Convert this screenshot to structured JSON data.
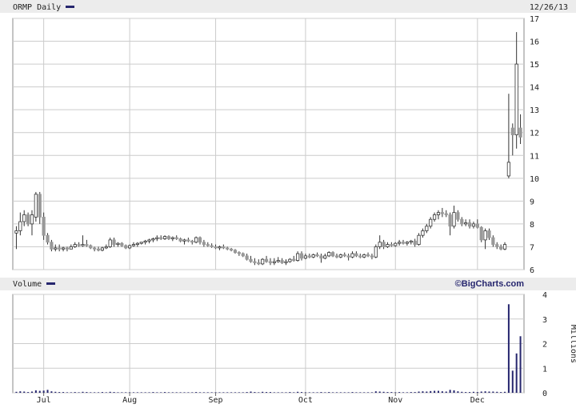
{
  "chart_data": [
    {
      "type": "candlestick",
      "ticker_label": "ORMP Daily",
      "date_label": "12/26/13",
      "y_ticks": [
        6,
        7,
        8,
        9,
        10,
        11,
        12,
        13,
        14,
        15,
        16,
        17
      ],
      "ylim": [
        6,
        17
      ],
      "x_labels": [
        "Jul",
        "Aug",
        "Sep",
        "Oct",
        "Nov",
        "Dec"
      ],
      "grid": true,
      "legend_color": "#26266e",
      "up_color": "#ffffff",
      "down_color": "#999999",
      "outline_color": "#333333",
      "candles": [
        [
          7.6,
          7.9,
          6.9,
          7.7
        ],
        [
          7.7,
          8.5,
          7.5,
          8.1
        ],
        [
          8.1,
          8.6,
          7.9,
          8.4
        ],
        [
          8.4,
          8.5,
          7.9,
          8.0
        ],
        [
          8.0,
          8.6,
          7.5,
          8.4
        ],
        [
          8.3,
          9.4,
          8.1,
          9.3
        ],
        [
          9.3,
          9.4,
          8.0,
          8.3
        ],
        [
          8.3,
          8.5,
          7.3,
          7.5
        ],
        [
          7.5,
          7.6,
          7.1,
          7.2
        ],
        [
          7.2,
          7.3,
          6.8,
          6.9
        ],
        [
          6.9,
          7.1,
          6.8,
          6.95
        ],
        [
          6.95,
          7.1,
          6.8,
          6.9
        ],
        [
          6.9,
          7.0,
          6.8,
          6.95
        ],
        [
          6.95,
          7.0,
          6.8,
          6.9
        ],
        [
          6.9,
          7.1,
          6.9,
          7.0
        ],
        [
          7.0,
          7.2,
          6.95,
          7.1
        ],
        [
          7.1,
          7.2,
          7.0,
          7.05
        ],
        [
          7.05,
          7.5,
          7.0,
          7.1
        ],
        [
          7.1,
          7.3,
          7.0,
          7.05
        ],
        [
          7.05,
          7.1,
          6.9,
          6.95
        ],
        [
          6.95,
          7.0,
          6.8,
          6.9
        ],
        [
          6.9,
          7.0,
          6.8,
          6.85
        ],
        [
          6.85,
          7.0,
          6.8,
          6.95
        ],
        [
          6.95,
          7.1,
          6.9,
          7.0
        ],
        [
          7.0,
          7.4,
          6.95,
          7.3
        ],
        [
          7.3,
          7.4,
          7.0,
          7.1
        ],
        [
          7.1,
          7.2,
          7.0,
          7.15
        ],
        [
          7.15,
          7.2,
          7.0,
          7.05
        ],
        [
          7.05,
          7.1,
          6.9,
          6.95
        ],
        [
          6.95,
          7.1,
          6.9,
          7.05
        ],
        [
          7.05,
          7.2,
          7.0,
          7.1
        ],
        [
          7.1,
          7.2,
          7.0,
          7.15
        ],
        [
          7.15,
          7.2,
          7.1,
          7.2
        ],
        [
          7.2,
          7.3,
          7.1,
          7.25
        ],
        [
          7.25,
          7.35,
          7.15,
          7.3
        ],
        [
          7.3,
          7.4,
          7.2,
          7.35
        ],
        [
          7.35,
          7.5,
          7.25,
          7.4
        ],
        [
          7.4,
          7.5,
          7.3,
          7.35
        ],
        [
          7.35,
          7.5,
          7.3,
          7.45
        ],
        [
          7.45,
          7.5,
          7.3,
          7.35
        ],
        [
          7.35,
          7.45,
          7.25,
          7.4
        ],
        [
          7.4,
          7.5,
          7.3,
          7.35
        ],
        [
          7.35,
          7.4,
          7.2,
          7.25
        ],
        [
          7.25,
          7.35,
          7.1,
          7.3
        ],
        [
          7.3,
          7.4,
          7.2,
          7.25
        ],
        [
          7.25,
          7.3,
          7.1,
          7.2
        ],
        [
          7.2,
          7.45,
          7.15,
          7.4
        ],
        [
          7.4,
          7.45,
          7.1,
          7.2
        ],
        [
          7.2,
          7.3,
          7.0,
          7.1
        ],
        [
          7.1,
          7.2,
          7.0,
          7.05
        ],
        [
          7.05,
          7.15,
          6.95,
          7.0
        ],
        [
          7.0,
          7.1,
          6.9,
          6.95
        ],
        [
          6.95,
          7.05,
          6.85,
          7.0
        ],
        [
          7.0,
          7.1,
          6.9,
          6.95
        ],
        [
          6.95,
          7.0,
          6.85,
          6.9
        ],
        [
          6.9,
          6.95,
          6.8,
          6.85
        ],
        [
          6.85,
          6.9,
          6.7,
          6.75
        ],
        [
          6.75,
          6.8,
          6.6,
          6.7
        ],
        [
          6.7,
          6.75,
          6.55,
          6.6
        ],
        [
          6.6,
          6.7,
          6.4,
          6.45
        ],
        [
          6.45,
          6.6,
          6.3,
          6.35
        ],
        [
          6.35,
          6.5,
          6.2,
          6.3
        ],
        [
          6.3,
          6.45,
          6.2,
          6.25
        ],
        [
          6.25,
          6.5,
          6.2,
          6.45
        ],
        [
          6.45,
          6.6,
          6.3,
          6.35
        ],
        [
          6.35,
          6.5,
          6.2,
          6.3
        ],
        [
          6.3,
          6.5,
          6.2,
          6.35
        ],
        [
          6.35,
          6.55,
          6.3,
          6.4
        ],
        [
          6.4,
          6.5,
          6.25,
          6.3
        ],
        [
          6.3,
          6.45,
          6.2,
          6.35
        ],
        [
          6.35,
          6.5,
          6.3,
          6.45
        ],
        [
          6.45,
          6.6,
          6.35,
          6.4
        ],
        [
          6.4,
          6.8,
          6.35,
          6.7
        ],
        [
          6.7,
          6.8,
          6.4,
          6.5
        ],
        [
          6.5,
          6.7,
          6.45,
          6.6
        ],
        [
          6.6,
          6.7,
          6.5,
          6.55
        ],
        [
          6.55,
          6.7,
          6.5,
          6.65
        ],
        [
          6.65,
          6.75,
          6.55,
          6.6
        ],
        [
          6.6,
          6.7,
          6.3,
          6.5
        ],
        [
          6.5,
          6.7,
          6.45,
          6.6
        ],
        [
          6.6,
          6.8,
          6.55,
          6.75
        ],
        [
          6.75,
          6.8,
          6.55,
          6.6
        ],
        [
          6.6,
          6.7,
          6.5,
          6.55
        ],
        [
          6.55,
          6.7,
          6.5,
          6.65
        ],
        [
          6.65,
          6.75,
          6.55,
          6.6
        ],
        [
          6.6,
          6.7,
          6.4,
          6.55
        ],
        [
          6.55,
          6.8,
          6.5,
          6.7
        ],
        [
          6.7,
          6.8,
          6.55,
          6.6
        ],
        [
          6.6,
          6.7,
          6.5,
          6.55
        ],
        [
          6.55,
          6.7,
          6.5,
          6.65
        ],
        [
          6.65,
          6.75,
          6.55,
          6.6
        ],
        [
          6.6,
          6.7,
          6.45,
          6.55
        ],
        [
          6.55,
          7.1,
          6.5,
          7.0
        ],
        [
          7.0,
          7.5,
          6.9,
          7.2
        ],
        [
          7.2,
          7.3,
          6.9,
          7.0
        ],
        [
          7.0,
          7.2,
          6.95,
          7.1
        ],
        [
          7.1,
          7.2,
          7.0,
          7.05
        ],
        [
          7.05,
          7.2,
          7.0,
          7.15
        ],
        [
          7.15,
          7.3,
          7.05,
          7.2
        ],
        [
          7.2,
          7.3,
          7.1,
          7.15
        ],
        [
          7.15,
          7.25,
          7.05,
          7.2
        ],
        [
          7.2,
          7.3,
          7.1,
          7.25
        ],
        [
          7.25,
          7.35,
          7.0,
          7.1
        ],
        [
          7.1,
          7.6,
          7.05,
          7.5
        ],
        [
          7.5,
          7.8,
          7.4,
          7.7
        ],
        [
          7.7,
          8.0,
          7.6,
          7.9
        ],
        [
          7.9,
          8.3,
          7.8,
          8.2
        ],
        [
          8.2,
          8.5,
          8.1,
          8.4
        ],
        [
          8.4,
          8.6,
          8.2,
          8.5
        ],
        [
          8.5,
          8.7,
          8.3,
          8.45
        ],
        [
          8.45,
          8.6,
          8.3,
          8.4
        ],
        [
          8.4,
          8.5,
          7.5,
          7.9
        ],
        [
          7.9,
          8.8,
          7.8,
          8.5
        ],
        [
          8.5,
          8.6,
          8.1,
          8.2
        ],
        [
          8.2,
          8.3,
          7.9,
          8.0
        ],
        [
          8.0,
          8.2,
          7.9,
          8.05
        ],
        [
          8.05,
          8.2,
          7.8,
          7.9
        ],
        [
          7.9,
          8.1,
          7.8,
          8.0
        ],
        [
          8.0,
          8.2,
          7.8,
          7.85
        ],
        [
          7.85,
          7.9,
          7.2,
          7.3
        ],
        [
          7.3,
          7.8,
          6.9,
          7.7
        ],
        [
          7.7,
          7.8,
          7.3,
          7.4
        ],
        [
          7.4,
          7.5,
          7.0,
          7.1
        ],
        [
          7.1,
          7.2,
          6.9,
          7.0
        ],
        [
          7.0,
          7.1,
          6.85,
          6.9
        ],
        [
          6.9,
          7.2,
          6.85,
          7.1
        ],
        [
          10.1,
          13.7,
          10.0,
          10.7
        ],
        [
          12.2,
          12.4,
          11.0,
          11.9
        ],
        [
          11.9,
          16.4,
          11.3,
          15.0
        ],
        [
          12.2,
          12.8,
          11.5,
          11.8
        ]
      ]
    },
    {
      "type": "bar",
      "title": "Volume",
      "brand": "©BigCharts.com",
      "y_ticks": [
        0,
        1,
        2,
        3,
        4
      ],
      "ylim": [
        0,
        4
      ],
      "ylabel": "Millions",
      "bar_color": "#26266e",
      "values": [
        0.04,
        0.06,
        0.05,
        0.03,
        0.05,
        0.1,
        0.08,
        0.09,
        0.12,
        0.06,
        0.04,
        0.03,
        0.03,
        0.02,
        0.02,
        0.03,
        0.02,
        0.04,
        0.03,
        0.02,
        0.02,
        0.02,
        0.03,
        0.02,
        0.04,
        0.03,
        0.02,
        0.02,
        0.02,
        0.02,
        0.02,
        0.02,
        0.02,
        0.02,
        0.02,
        0.03,
        0.02,
        0.02,
        0.03,
        0.02,
        0.02,
        0.02,
        0.02,
        0.02,
        0.02,
        0.02,
        0.03,
        0.02,
        0.02,
        0.02,
        0.02,
        0.02,
        0.02,
        0.02,
        0.02,
        0.02,
        0.02,
        0.02,
        0.02,
        0.03,
        0.05,
        0.03,
        0.02,
        0.04,
        0.03,
        0.03,
        0.02,
        0.02,
        0.02,
        0.02,
        0.03,
        0.02,
        0.04,
        0.03,
        0.02,
        0.02,
        0.02,
        0.02,
        0.03,
        0.02,
        0.03,
        0.02,
        0.02,
        0.02,
        0.02,
        0.02,
        0.03,
        0.02,
        0.02,
        0.02,
        0.02,
        0.02,
        0.06,
        0.05,
        0.04,
        0.03,
        0.03,
        0.02,
        0.03,
        0.02,
        0.02,
        0.03,
        0.03,
        0.05,
        0.06,
        0.05,
        0.07,
        0.08,
        0.08,
        0.06,
        0.05,
        0.12,
        0.1,
        0.06,
        0.04,
        0.03,
        0.03,
        0.04,
        0.03,
        0.05,
        0.06,
        0.05,
        0.05,
        0.04,
        0.03,
        0.04,
        3.6,
        0.9,
        1.6,
        2.3
      ]
    }
  ]
}
